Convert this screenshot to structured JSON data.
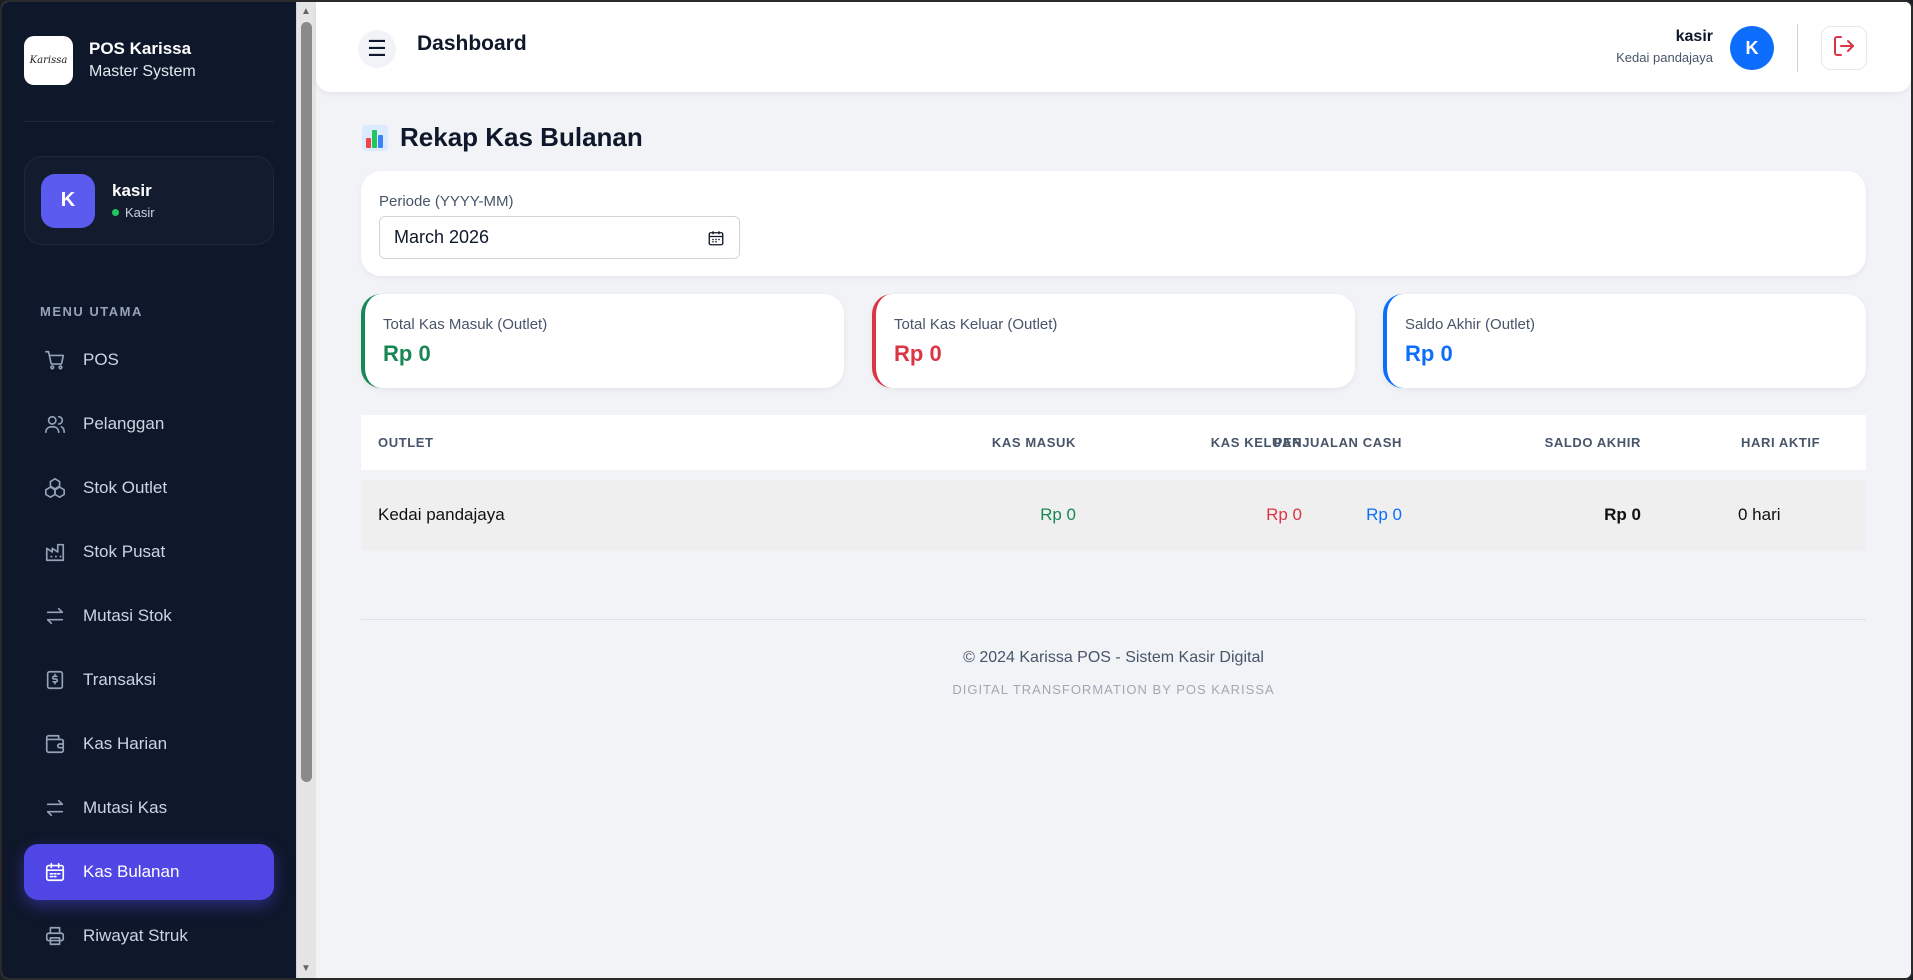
{
  "brand": {
    "logo_text": "Karissa",
    "title": "POS Karissa",
    "subtitle": "Master System"
  },
  "user_card": {
    "initial": "K",
    "name": "kasir",
    "role": "Kasir"
  },
  "menu_label": "MENU UTAMA",
  "menu": [
    {
      "label": "POS",
      "icon": "cart-icon"
    },
    {
      "label": "Pelanggan",
      "icon": "users-icon"
    },
    {
      "label": "Stok Outlet",
      "icon": "boxes-icon"
    },
    {
      "label": "Stok Pusat",
      "icon": "factory-icon"
    },
    {
      "label": "Mutasi Stok",
      "icon": "transfer-icon"
    },
    {
      "label": "Transaksi",
      "icon": "receipt-icon"
    },
    {
      "label": "Kas Harian",
      "icon": "wallet-icon"
    },
    {
      "label": "Mutasi Kas",
      "icon": "transfer-icon"
    },
    {
      "label": "Kas Bulanan",
      "icon": "calendar-icon",
      "active": true
    },
    {
      "label": "Riwayat Struk",
      "icon": "printer-icon"
    }
  ],
  "topbar": {
    "title": "Dashboard",
    "user_name": "kasir",
    "outlet": "Kedai pandajaya",
    "avatar_initial": "K"
  },
  "page": {
    "title": "Rekap Kas Bulanan"
  },
  "period": {
    "label": "Periode (YYYY-MM)",
    "value": "March 2026"
  },
  "stats": [
    {
      "label": "Total Kas Masuk (Outlet)",
      "value": "Rp 0",
      "color": "#198754"
    },
    {
      "label": "Total Kas Keluar (Outlet)",
      "value": "Rp 0",
      "color": "#dc3545"
    },
    {
      "label": "Saldo Akhir (Outlet)",
      "value": "Rp 0",
      "color": "#0d6efd"
    }
  ],
  "table": {
    "headers": [
      "OUTLET",
      "KAS MASUK",
      "KAS KELUAR",
      "PENJUALAN CASH",
      "SALDO AKHIR",
      "HARI AKTIF"
    ],
    "rows": [
      {
        "outlet": "Kedai pandajaya",
        "kas_masuk": "Rp 0",
        "kas_keluar": "Rp 0",
        "penjualan_cash": "Rp 0",
        "saldo_akhir": "Rp 0",
        "hari_aktif": "0 hari"
      }
    ]
  },
  "footer": {
    "main": "© 2024 Karissa POS - Sistem Kasir Digital",
    "sub": "DIGITAL TRANSFORMATION BY POS KARISSA"
  },
  "colors": {
    "sidebar_bg": "#0f172a",
    "accent": "#4f46e5",
    "green": "#198754",
    "red": "#dc3545",
    "blue": "#0d6efd"
  }
}
